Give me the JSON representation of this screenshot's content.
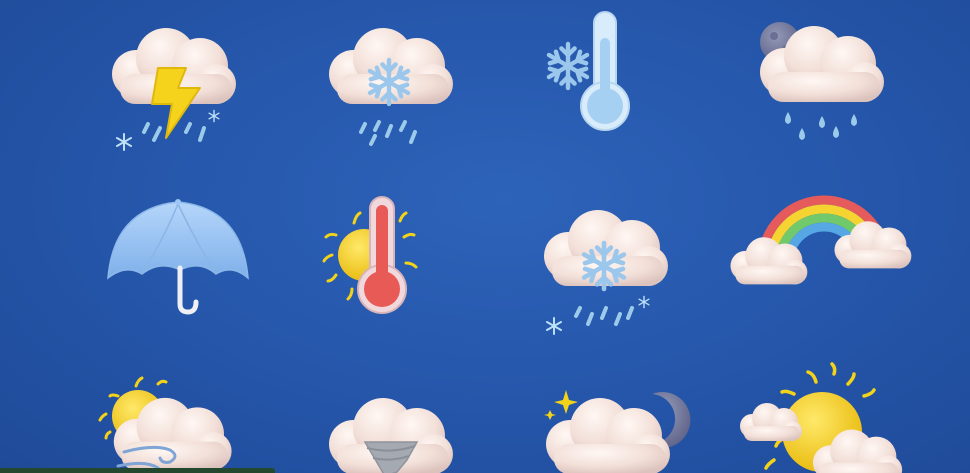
{
  "colors": {
    "background": "#2658ad",
    "cloud": "#f4e3dc",
    "snowflake": "#9cc7ec",
    "raindrop": "#9ccbea",
    "lightning": "#f5d31c",
    "sun": "#f3d21a",
    "thermometer_cold": "#a6d0f2",
    "thermometer_hot": "#e85a56",
    "umbrella": "#9cc6f3",
    "moon": "#7b7fa3",
    "tornado": "#a4a9b2",
    "wind": "#7fa4d6",
    "rainbow": [
      "#e55a5a",
      "#f5d431",
      "#71c96b",
      "#56a7e4"
    ]
  },
  "grid": {
    "rows": [
      [
        "thunderstorm-icon",
        "snow-cloud-icon",
        "cold-thermometer-icon",
        "night-rain-cloud-icon"
      ],
      [
        "umbrella-icon",
        "hot-thermometer-icon",
        "snow-sleet-cloud-icon",
        "rainbow-clouds-icon"
      ],
      [
        "windy-sun-cloud-icon",
        "tornado-cloud-icon",
        "moon-star-cloud-icon",
        "sun-behind-clouds-icon"
      ]
    ]
  }
}
